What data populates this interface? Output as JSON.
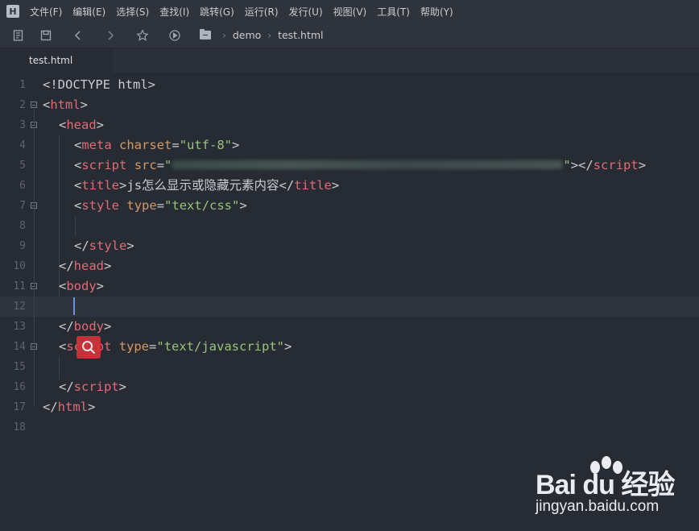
{
  "menubar": {
    "logo": "H",
    "items": [
      "文件(F)",
      "编辑(E)",
      "选择(S)",
      "查找(I)",
      "跳转(G)",
      "运行(R)",
      "发行(U)",
      "视图(V)",
      "工具(T)",
      "帮助(Y)"
    ]
  },
  "toolbar": {
    "icons": [
      "new-file-icon",
      "save-icon",
      "back-icon",
      "forward-icon",
      "star-icon",
      "run-icon"
    ],
    "breadcrumb": {
      "folder_icon": "folder-icon",
      "folder": "demo",
      "file": "test.html"
    }
  },
  "tab": {
    "label": "test.html"
  },
  "editor": {
    "line_numbers": [
      "1",
      "2",
      "3",
      "4",
      "5",
      "6",
      "7",
      "8",
      "9",
      "10",
      "11",
      "12",
      "13",
      "14",
      "15",
      "16",
      "17",
      "18"
    ],
    "lines": {
      "l1": "<!DOCTYPE html>",
      "l2": {
        "open": "<",
        "tag": "html",
        "close": ">"
      },
      "l3": {
        "open": "<",
        "tag": "head",
        "close": ">"
      },
      "l4": {
        "open": "<",
        "tag": "meta",
        "attr": "charset",
        "eq": "=",
        "val": "\"utf-8\"",
        "close": ">"
      },
      "l5": {
        "open": "<",
        "tag": "script",
        "attr": "src",
        "eq": "=",
        "quote": "\"",
        "end": "\"></",
        "tag2": "script",
        "close": ">"
      },
      "l6": {
        "open": "<",
        "tag": "title",
        "close": ">",
        "text": "js怎么显示或隐藏元素内容",
        "open2": "</",
        "tag2": "title",
        "close2": ">"
      },
      "l7": {
        "open": "<",
        "tag": "style",
        "attr": "type",
        "eq": "=",
        "val": "\"text/css\"",
        "close": ">"
      },
      "l9": {
        "open": "</",
        "tag": "style",
        "close": ">"
      },
      "l10": {
        "open": "</",
        "tag": "head",
        "close": ">"
      },
      "l11": {
        "open": "<",
        "tag": "body",
        "close": ">"
      },
      "l13": {
        "open": "</",
        "tag": "body",
        "close": ">"
      },
      "l14": {
        "open": "<",
        "tag": "script",
        "attr": "type",
        "eq": "=",
        "val": "\"text/javascript\"",
        "close": ">"
      },
      "l16": {
        "open": "</",
        "tag": "script",
        "close": ">"
      },
      "l17": {
        "open": "</",
        "tag": "html",
        "close": ">"
      }
    },
    "current_line": 12
  },
  "watermark": {
    "brand": "Bai du 经验",
    "url": "jingyan.baidu.com"
  },
  "colors": {
    "tag": "#e06c75",
    "attr": "#d19a66",
    "string": "#98c379",
    "background": "#272b33",
    "search_popup": "#d0343a"
  }
}
